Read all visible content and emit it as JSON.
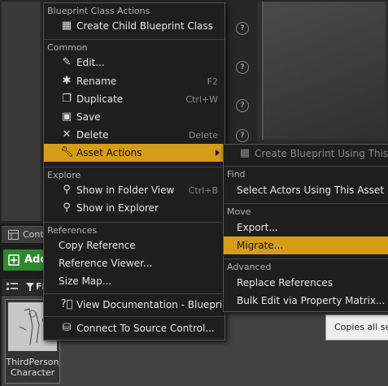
{
  "background": {
    "content_browser_tab": "Cont",
    "add_button": "Add",
    "filter_label": "Fi",
    "asset_name_line1": "ThirdPerson",
    "asset_name_line2": "Character",
    "tooltip_text": "Copies all se",
    "help_glyph": "?"
  },
  "menu": {
    "sections": {
      "blueprint_class_actions": "Blueprint Class Actions",
      "common": "Common",
      "explore": "Explore",
      "references": "References"
    },
    "items": {
      "create_child": "Create Child Blueprint Class",
      "edit": "Edit...",
      "rename": "Rename",
      "rename_sc": "F2",
      "duplicate": "Duplicate",
      "duplicate_sc": "Ctrl+W",
      "save": "Save",
      "delete": "Delete",
      "delete_sc": "Delete",
      "asset_actions": "Asset Actions",
      "show_folder": "Show in Folder View",
      "show_folder_sc": "Ctrl+B",
      "show_explorer": "Show in Explorer",
      "copy_reference": "Copy Reference",
      "reference_viewer": "Reference Viewer...",
      "size_map": "Size Map...",
      "view_docs": "View Documentation - Blueprint",
      "connect_source": "Connect To Source Control..."
    }
  },
  "submenu": {
    "create_bp_using": "Create Blueprint Using This...",
    "find_header": "Find",
    "select_actors": "Select Actors Using This Asset",
    "move_header": "Move",
    "export": "Export...",
    "migrate": "Migrate...",
    "advanced_header": "Advanced",
    "replace_refs": "Replace References",
    "bulk_edit": "Bulk Edit via Property Matrix..."
  },
  "colors": {
    "highlight": "#d59d16",
    "add_button": "#2f8a2f",
    "menu_bg": "#1e1e1e"
  }
}
